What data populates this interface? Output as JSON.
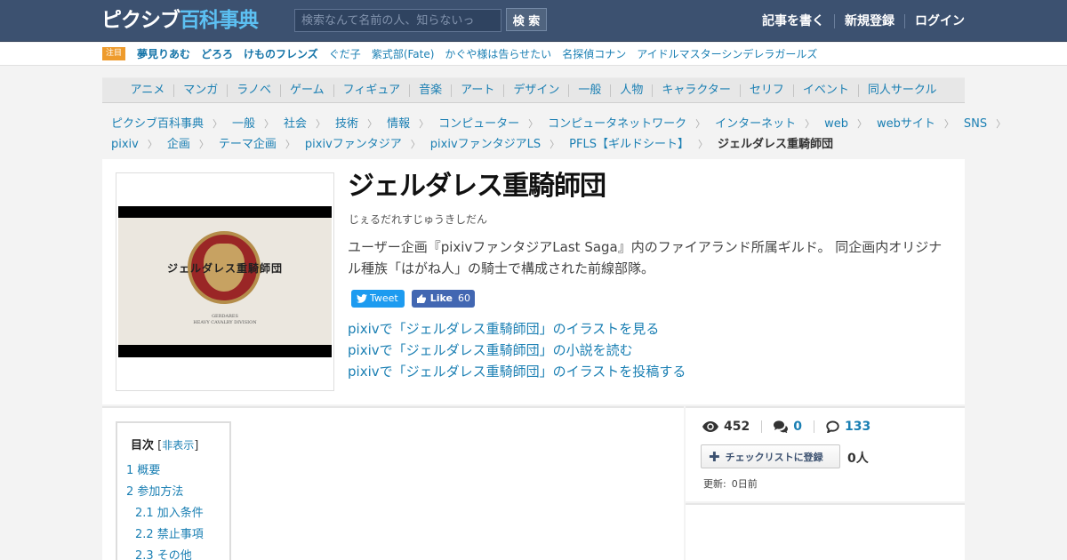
{
  "header": {
    "logo_a": "ピクシブ",
    "logo_b": "百科事典",
    "search_placeholder": "検索なんて名前の人、知らないっ",
    "search_button": "検 索",
    "nav": [
      "記事を書く",
      "新規登録",
      "ログイン"
    ]
  },
  "trending": {
    "badge": "注目",
    "items": [
      {
        "label": "夢見りあむ",
        "bold": true
      },
      {
        "label": "どろろ",
        "bold": true
      },
      {
        "label": "けものフレンズ",
        "bold": true
      },
      {
        "label": "ぐだ子",
        "bold": false
      },
      {
        "label": "紫式部(Fate)",
        "bold": false
      },
      {
        "label": "かぐや様は告らせたい",
        "bold": false
      },
      {
        "label": "名探偵コナン",
        "bold": false
      },
      {
        "label": "アイドルマスターシンデレラガールズ",
        "bold": false
      }
    ]
  },
  "categories": [
    "アニメ",
    "マンガ",
    "ラノベ",
    "ゲーム",
    "フィギュア",
    "音楽",
    "アート",
    "デザイン",
    "一般",
    "人物",
    "キャラクター",
    "セリフ",
    "イベント",
    "同人サークル"
  ],
  "breadcrumb": {
    "row1": [
      "ピクシブ百科事典",
      "一般",
      "社会",
      "技術",
      "情報",
      "コンピューター",
      "コンピュータネットワーク",
      "インターネット",
      "web",
      "webサイト",
      "SNS"
    ],
    "row2": [
      "pixiv",
      "企画",
      "テーマ企画",
      "pixivファンタジア",
      "pixivファンタジアLS",
      "PFLS【ギルドシート】"
    ],
    "current": "ジェルダレス重騎師団"
  },
  "article": {
    "title": "ジェルダレス重騎師団",
    "reading": "じぇるだれすじゅうきしだん",
    "summary": "ユーザー企画『pixivファンタジアLast Saga』内のファイアランド所属ギルド。 同企画内オリジナル種族「はがね人」の騎士で構成された前線部隊。",
    "thumb_title": "ジェルダレス重騎師団",
    "thumb_sub1": "GERDARES",
    "thumb_sub2": "HEAVY CAVALRY DIVISION",
    "tweet_label": "Tweet",
    "like_label": "Like",
    "like_count": "60",
    "links": [
      "pixivで「ジェルダレス重騎師団」のイラストを見る",
      "pixivで「ジェルダレス重騎師団」の小説を読む",
      "pixivで「ジェルダレス重騎師団」のイラストを投稿する"
    ]
  },
  "toc": {
    "title": "目次",
    "toggle": "非表示",
    "items": [
      {
        "label": "1 概要",
        "sub": false
      },
      {
        "label": "2 参加方法",
        "sub": false
      },
      {
        "label": "2.1 加入条件",
        "sub": true
      },
      {
        "label": "2.2 禁止事項",
        "sub": true
      },
      {
        "label": "2.3 その他",
        "sub": true
      }
    ]
  },
  "side": {
    "views": "452",
    "comments": "0",
    "dic_comments": "133",
    "checklist_label": "チェックリストに登録",
    "checklist_count": "0人",
    "updated_label": "更新:",
    "updated_value": "0日前"
  },
  "colors": {
    "header_bg": "#3c5170",
    "link": "#1a7fb3",
    "trend_badge": "#ee9b2c",
    "tweet": "#1d9bf0",
    "like": "#4267b2"
  }
}
